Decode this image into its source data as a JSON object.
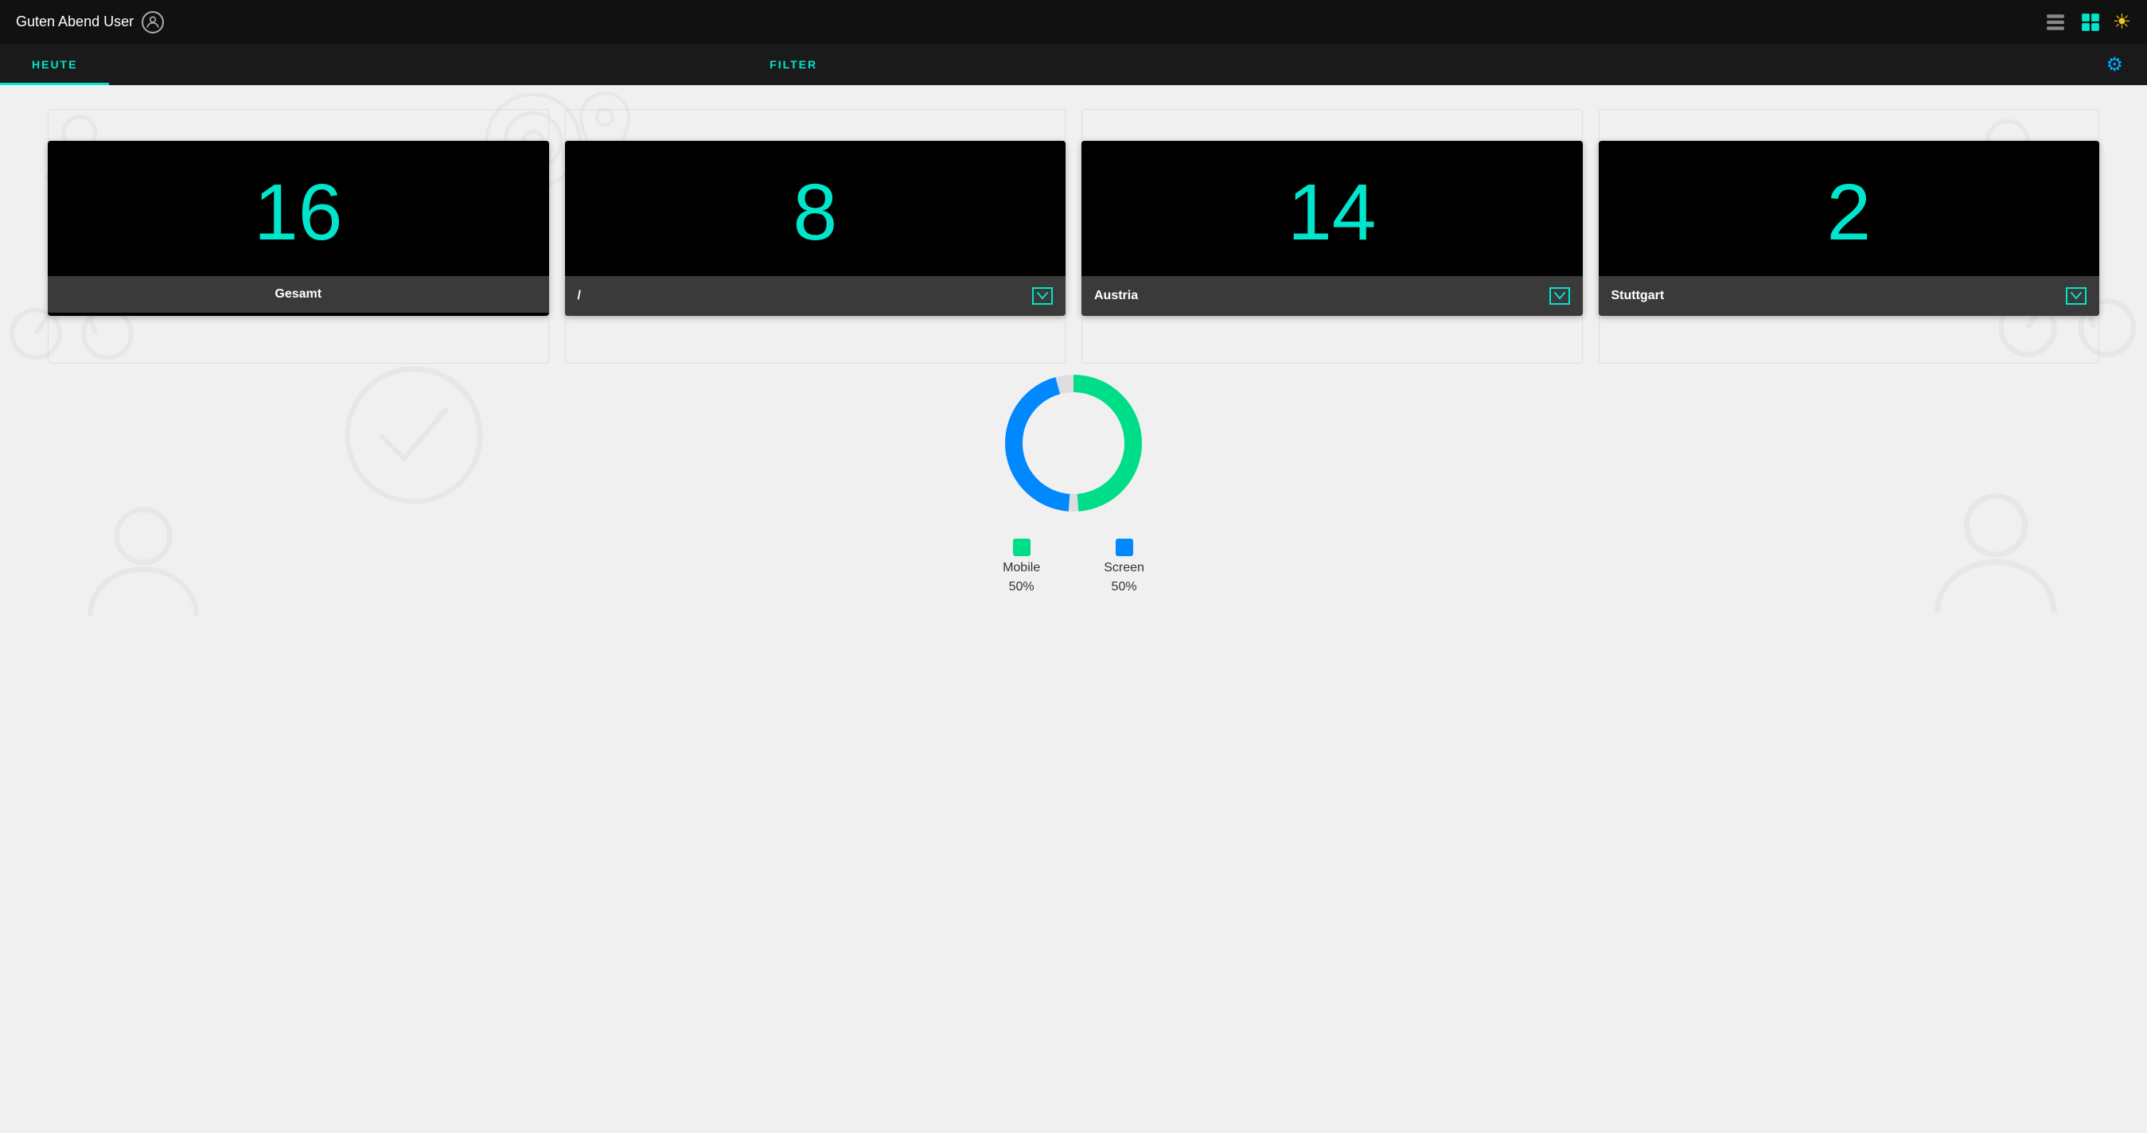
{
  "header": {
    "greeting": "Guten Abend User",
    "user_icon": "person-circle"
  },
  "toolbar": {
    "list_view_icon": "list-grid",
    "tile_view_icon": "tile-grid",
    "sun_icon": "sun"
  },
  "nav": {
    "tab_heute": "HEUTE",
    "tab_filter": "FILTER",
    "gear_icon": "gear"
  },
  "cards": [
    {
      "id": "gesamt",
      "number": "16",
      "label": "Gesamt",
      "has_dropdown": false
    },
    {
      "id": "slash",
      "number": "8",
      "label": "/",
      "has_dropdown": true
    },
    {
      "id": "austria",
      "number": "14",
      "label": "Austria",
      "has_dropdown": true
    },
    {
      "id": "stuttgart",
      "number": "2",
      "label": "Stuttgart",
      "has_dropdown": true
    }
  ],
  "chart": {
    "mobile_color": "#00dd88",
    "screen_color": "#0088ff",
    "mobile_pct": "50%",
    "screen_pct": "50%",
    "mobile_label": "Mobile",
    "screen_label": "Screen"
  }
}
